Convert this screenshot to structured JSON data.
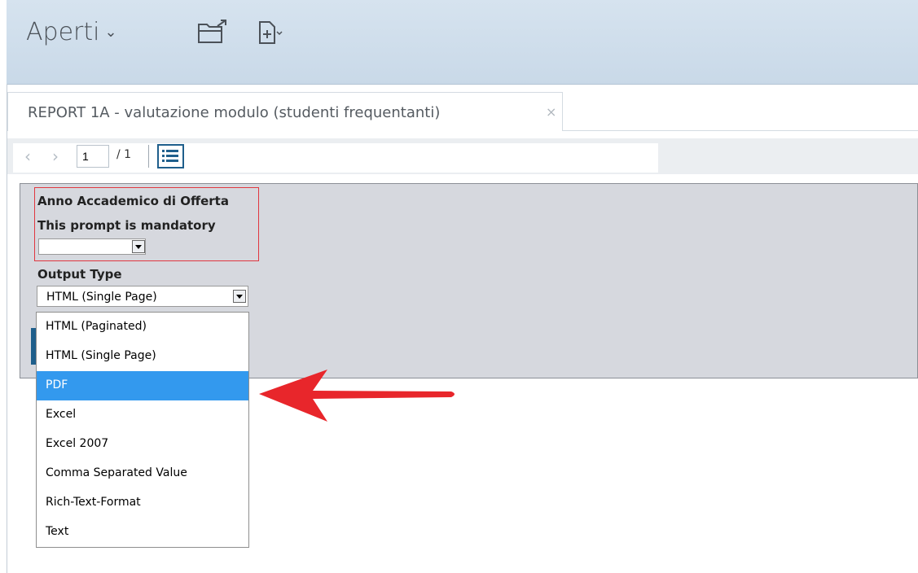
{
  "header": {
    "title": "Aperti",
    "icons": [
      "chevron-down-icon",
      "open-folder-icon",
      "new-document-icon"
    ]
  },
  "tab": {
    "label": "REPORT 1A - valutazione modulo (studenti frequentanti)",
    "close": "×"
  },
  "toolbar": {
    "page_value": "1",
    "page_total": "/ 1",
    "prev": "‹",
    "next": "›"
  },
  "prompts": {
    "year_label": "Anno Accademico di Offerta",
    "mandatory_text": "This prompt is mandatory",
    "output_label": "Output Type",
    "output_selected": "HTML (Single Page)"
  },
  "dropdown": {
    "options": [
      "HTML (Paginated)",
      "HTML (Single Page)",
      "PDF",
      "Excel",
      "Excel 2007",
      "Comma Separated Value",
      "Rich-Text-Format",
      "Text"
    ],
    "highlighted": "PDF"
  },
  "colors": {
    "highlight": "#3399ee",
    "arrow": "#e8262b",
    "mandatory_border": "#e0373f"
  }
}
